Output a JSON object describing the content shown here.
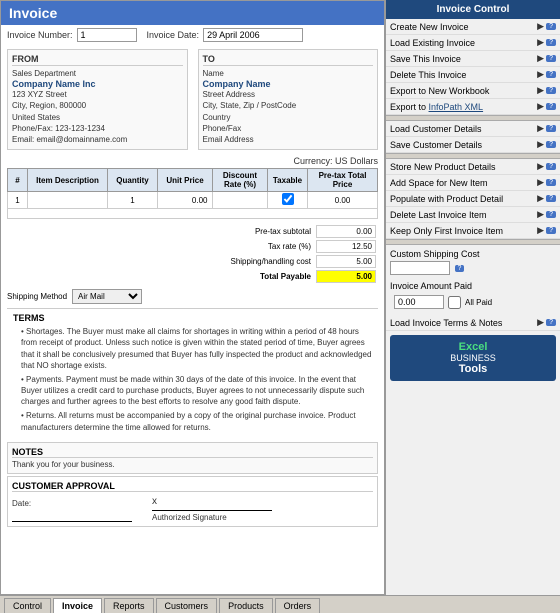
{
  "header": {
    "title": "Invoice"
  },
  "control_panel": {
    "title": "Invoice Control",
    "buttons": [
      {
        "label": "Create New Invoice",
        "id": "create-new"
      },
      {
        "label": "Load Existing Invoice",
        "id": "load-existing"
      },
      {
        "label": "Save This Invoice",
        "id": "save"
      },
      {
        "label": "Delete This Invoice",
        "id": "delete"
      },
      {
        "label": "Export to New Workbook",
        "id": "export-workbook"
      },
      {
        "label": "Export to  InfoPath XML",
        "id": "export-xml"
      },
      {
        "label": "Load Customer Details",
        "id": "load-customer"
      },
      {
        "label": "Save Customer Details",
        "id": "save-customer"
      },
      {
        "label": "Store New Product Details",
        "id": "store-product"
      },
      {
        "label": "Add Space for New Item",
        "id": "add-space"
      },
      {
        "label": "Populate with Product Detail",
        "id": "populate"
      },
      {
        "label": "Delete Last Invoice Item",
        "id": "delete-last"
      },
      {
        "label": "Keep Only First Invoice Item",
        "id": "keep-first"
      }
    ]
  },
  "invoice": {
    "number_label": "Invoice Number:",
    "number_value": "1",
    "date_label": "Invoice Date:",
    "date_value": "29 April 2006",
    "from_label": "FROM",
    "from_dept": "Sales Department",
    "from_company": "Company Name Inc",
    "from_address1": "123 XYZ Street",
    "from_address2": "City, Region, 800000",
    "from_address3": "United States",
    "from_phone": "Phone/Fax: 123-123-1234",
    "from_email": "Email: email@domainname.com",
    "to_label": "TO",
    "to_name": "Name",
    "to_company": "Company Name",
    "to_address1": "Street Address",
    "to_address2": "City, State, Zip / PostCode",
    "to_address3": "Country",
    "to_phone": "Phone/Fax",
    "to_email": "Email Address",
    "currency_label": "Currency: US Dollars",
    "items_header": "Item Description",
    "col_hash": "#",
    "col_qty": "Quantity",
    "col_unit": "Unit Price",
    "col_disc": "Discount Rate (%)",
    "col_tax": "Taxable",
    "col_price": "Pre-tax Total Price",
    "item_number": "1",
    "item_qty": "1",
    "item_unit": "0.00",
    "item_disc": "",
    "item_tax": "☑",
    "item_price": "0.00",
    "pretax_label": "Pre-tax subtotal",
    "pretax_value": "0.00",
    "taxrate_label": "Tax rate (%)",
    "taxrate_value": "12.50",
    "handling_label": "Shipping/handling cost",
    "handling_value": "5.00",
    "total_label": "Total Payable",
    "total_value": "5.00",
    "shipping_label": "Shipping Method",
    "shipping_method": "Air Mail",
    "terms_header": "TERMS",
    "term1": "Shortages. The Buyer must make all claims for shortages in writing within a period of 48 hours from receipt of product. Unless such notice is given within the stated period of time, Buyer agrees that it shall be conclusively presumed that Buyer has fully inspected the product and acknowledged that NO shortage exists.",
    "term2": "Payments. Payment must be made within 30 days of the date of this invoice. In the event that Buyer utilizes a credit card to purchase products, Buyer agrees to not unnecessarily dispute such charges and further agrees to the best efforts to resolve any good faith dispute.",
    "term3": "Returns. All returns must be accompanied by a copy of the original purchase invoice. Product manufacturers determine the time allowed for returns.",
    "notes_header": "NOTES",
    "notes_text": "Thank you for your business.",
    "approval_header": "CUSTOMER APPROVAL",
    "approval_date_label": "Date:",
    "approval_sig_label": "Authorized Signature",
    "approval_x": "x",
    "custom_shipping_label": "Custom Shipping Cost",
    "custom_shipping_value": "",
    "amount_paid_label": "Invoice Amount Paid",
    "amount_paid_value": "0.00",
    "all_paid_label": "All Paid",
    "load_terms_label": "Load Invoice Terms & Notes",
    "export_infopath": "InfoPath XML"
  },
  "logo": {
    "excel": "Excel",
    "business": "BUSINESS",
    "tools": "Tools"
  },
  "tabs": [
    {
      "label": "Control",
      "active": false
    },
    {
      "label": "Invoice",
      "active": true
    },
    {
      "label": "Reports",
      "active": false
    },
    {
      "label": "Customers",
      "active": false
    },
    {
      "label": "Products",
      "active": false
    },
    {
      "label": "Orders",
      "active": false
    }
  ]
}
